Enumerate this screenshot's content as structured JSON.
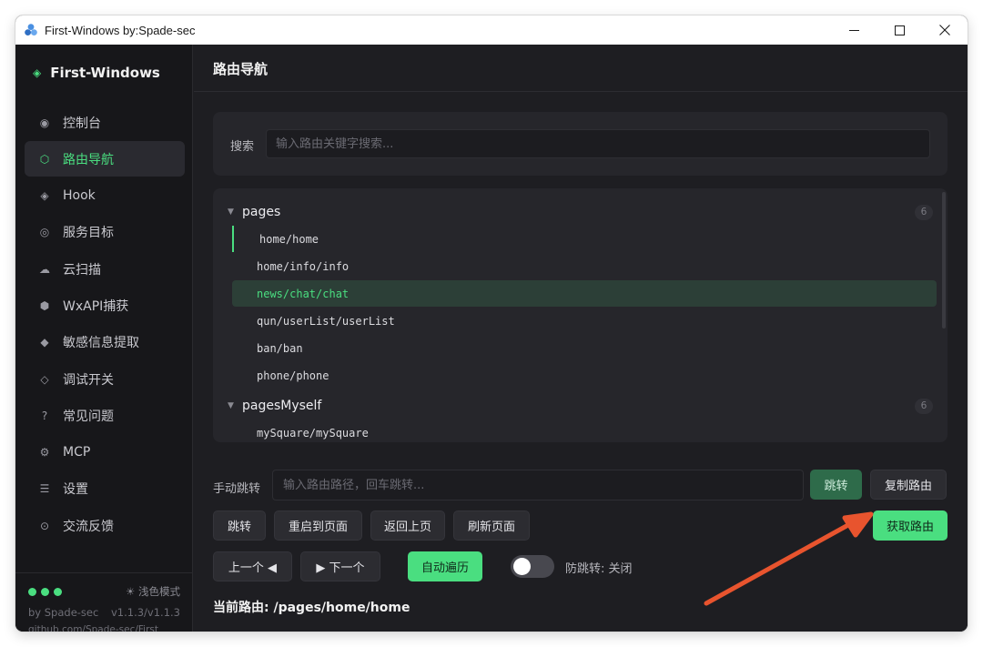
{
  "window": {
    "title": "First-Windows  by:Spade-sec",
    "controls": {
      "minimize": "—",
      "maximize": "☐",
      "close": "✕"
    }
  },
  "sidebar": {
    "brand": "First-Windows",
    "items": [
      {
        "icon": "dashboard-icon",
        "glyph": "◉",
        "label": "控制台"
      },
      {
        "icon": "hexagon-icon",
        "glyph": "⬡",
        "label": "路由导航",
        "active": true
      },
      {
        "icon": "diamond-icon",
        "glyph": "◈",
        "label": "Hook"
      },
      {
        "icon": "target-icon",
        "glyph": "◎",
        "label": "服务目标"
      },
      {
        "icon": "cloud-icon",
        "glyph": "☁",
        "label": "云扫描"
      },
      {
        "icon": "hexagon-filled-icon",
        "glyph": "⬢",
        "label": "WxAPI捕获"
      },
      {
        "icon": "small-diamond-icon",
        "glyph": "◆",
        "label": "敏感信息提取"
      },
      {
        "icon": "small-diamond-outline-icon",
        "glyph": "◇",
        "label": "调试开关"
      },
      {
        "icon": "question-icon",
        "glyph": "?",
        "label": "常见问题"
      },
      {
        "icon": "gear-icon",
        "glyph": "⚙",
        "label": "MCP"
      },
      {
        "icon": "menu-icon",
        "glyph": "☰",
        "label": "设置"
      },
      {
        "icon": "circle-dot-icon",
        "glyph": "⊙",
        "label": "交流反馈"
      }
    ],
    "footer": {
      "theme_toggle": "☀ 浅色模式",
      "by": "by Spade-sec",
      "version": "v1.1.3/v1.1.3",
      "github": "github.com/Spade-sec/First"
    }
  },
  "main": {
    "title": "路由导航",
    "search": {
      "label": "搜索",
      "placeholder": "输入路由关键字搜索...",
      "value": ""
    },
    "groups": [
      {
        "name": "pages",
        "count": "6",
        "routes": [
          {
            "path": "home/home",
            "state": "current"
          },
          {
            "path": "home/info/info",
            "state": ""
          },
          {
            "path": "news/chat/chat",
            "state": "selected"
          },
          {
            "path": "qun/userList/userList",
            "state": ""
          },
          {
            "path": "ban/ban",
            "state": ""
          },
          {
            "path": "phone/phone",
            "state": ""
          }
        ]
      },
      {
        "name": "pagesMyself",
        "count": "6",
        "routes": [
          {
            "path": "mySquare/mySquare",
            "state": ""
          }
        ]
      }
    ],
    "manual_jump": {
      "label": "手动跳转",
      "placeholder": "输入路由路径，回车跳转...",
      "value": "",
      "jump_button": "跳转",
      "copy_button": "复制路由"
    },
    "actions": {
      "jump": "跳转",
      "relaunch": "重启到页面",
      "back": "返回上页",
      "refresh": "刷新页面",
      "get_routes": "获取路由"
    },
    "nav": {
      "prev": "上一个 ◀",
      "next": "▶ 下一个",
      "auto_traverse": "自动遍历",
      "anti_jump_label": "防跳转: 关闭",
      "anti_jump_on": false
    },
    "current_route": "当前路由: /pages/home/home"
  },
  "colors": {
    "accent": "#4ade80",
    "annotation_arrow": "#e8542e",
    "background": "#1e1e22",
    "sidebar": "#17171a"
  }
}
